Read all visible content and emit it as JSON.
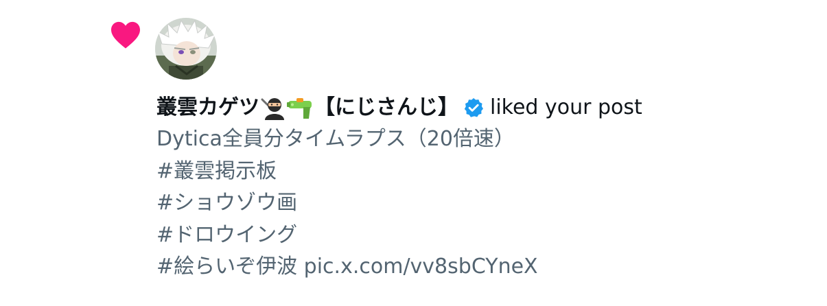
{
  "notification": {
    "type_icon": "heart-icon",
    "accent_color": "#f91880",
    "verified_color": "#1d9bf0",
    "user": {
      "name_prefix": "叢雲カゲツ",
      "name_suffix": "【にじさんじ】",
      "emoji": [
        "ninja-emoji",
        "water-pistol-emoji"
      ],
      "verified": true
    },
    "action": "liked your post",
    "post": {
      "lines": [
        "Dytica全員分タイムラプス（20倍速）",
        "#叢雲掲示板",
        "#ショウゾウ画",
        "#ドロウイング",
        "#絵らいぞ伊波 pic.x.com/vv8sbCYneX"
      ]
    }
  }
}
